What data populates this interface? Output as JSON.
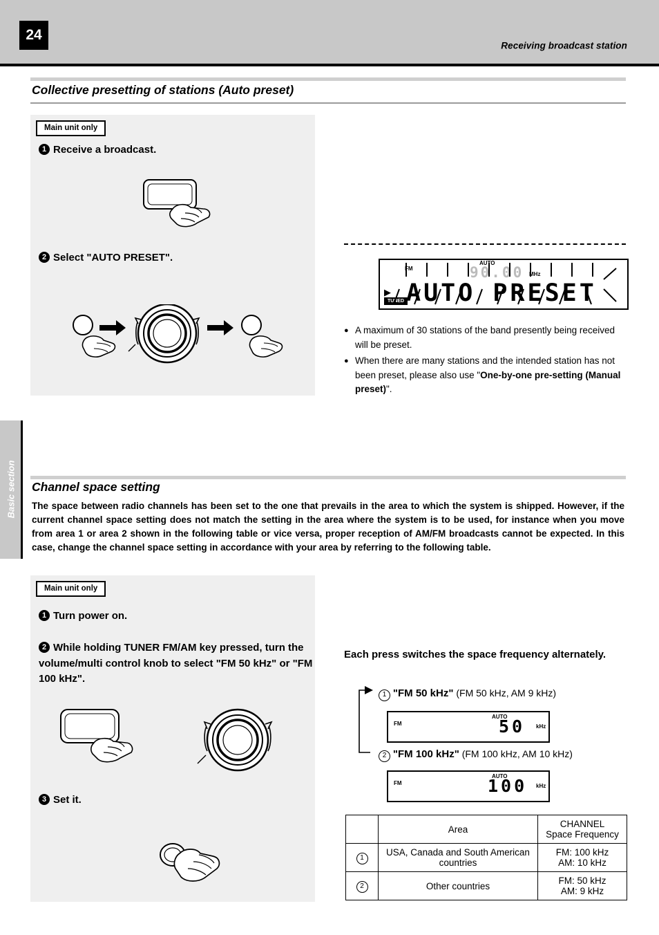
{
  "header": {
    "page_number": "24",
    "running_title": "Receiving broadcast station"
  },
  "side_tab": {
    "label": "Basic section"
  },
  "section1": {
    "title": "Collective presetting of stations (Auto preset)",
    "badge": "Main unit only",
    "steps": [
      {
        "num": "1",
        "text": "Receive a broadcast."
      },
      {
        "num": "2",
        "text": "Select \"AUTO  PRESET\"."
      }
    ],
    "display": {
      "fm": "FM",
      "auto": "AUTO",
      "frequency": "90.00",
      "unit": "MHz",
      "main": "AUTO PRESET",
      "mode_tag": "TUNED"
    },
    "notes": [
      {
        "parts": [
          {
            "t": "A maximum of 30 stations of the band presently being received will be preset.",
            "b": false
          }
        ]
      },
      {
        "parts": [
          {
            "t": "When there are many stations and the intended station has not been preset, please also use \"",
            "b": false
          },
          {
            "t": "One-by-one pre-setting (Manual preset)",
            "b": true
          },
          {
            "t": "\".",
            "b": false
          }
        ]
      }
    ]
  },
  "section2": {
    "title": "Channel space setting",
    "paragraph": "The space between radio channels has been set to the one that prevails in the area to which the system is shipped. However, if the current channel space setting does not match the setting in the area where the system is to be used, for instance when you move from area 1 or area 2 shown in the following table or vice versa, proper reception of AM/FM broadcasts cannot be expected. In this case, change the channel space setting in accordance with your area by referring to the following table.",
    "badge": "Main unit only",
    "steps": [
      {
        "num": "1",
        "text": "Turn power on."
      },
      {
        "num": "2",
        "text": "While holding TUNER FM/AM key pressed, turn the volume/multi control knob to select \"FM 50 kHz\" or \"FM 100 kHz\"."
      },
      {
        "num": "3",
        "text": "Set it."
      }
    ],
    "each_press": "Each press switches the space frequency alternately.",
    "options": [
      {
        "index": "1",
        "label": "\"FM 50 kHz\"",
        "detail": "(FM 50 kHz, AM 9 kHz)",
        "display": {
          "fm": "FM",
          "auto": "AUTO",
          "value": "50",
          "unit": "kHz"
        }
      },
      {
        "index": "2",
        "label": "\"FM 100 kHz\"",
        "detail": "(FM 100 kHz, AM 10 kHz)",
        "display": {
          "fm": "FM",
          "auto": "AUTO",
          "value": "100",
          "unit": "kHz"
        }
      }
    ],
    "table": {
      "headers": [
        "Area",
        "CHANNEL",
        "Space Frequency"
      ],
      "rows": [
        {
          "index": "1",
          "area": "USA, Canada and South American countries",
          "freq_line1": "FM: 100 kHz",
          "freq_line2": "AM: 10 kHz"
        },
        {
          "index": "2",
          "area": "Other countries",
          "freq_line1": "FM: 50 kHz",
          "freq_line2": "AM: 9 kHz"
        }
      ]
    }
  }
}
